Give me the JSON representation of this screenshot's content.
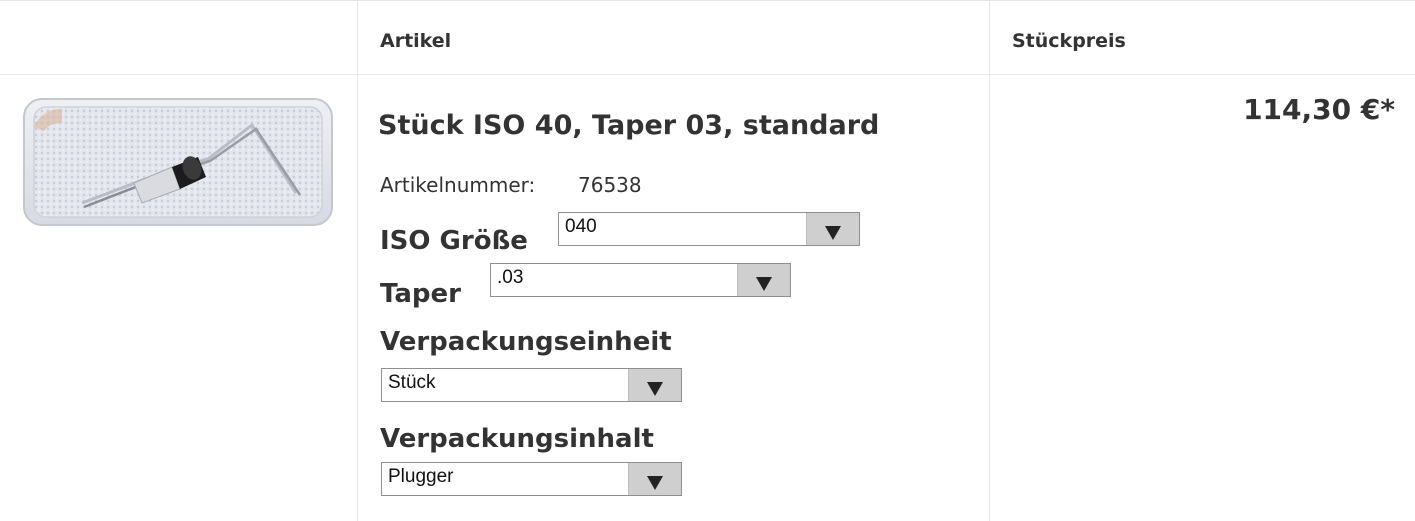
{
  "table": {
    "header": {
      "article": "Artikel",
      "unit_price": "Stückpreis"
    }
  },
  "product": {
    "image_alt": "Plugger",
    "title": "Stück ISO 40, Taper 03, standard",
    "sku_label": "Artikelnummer:",
    "sku_value": "76538",
    "price": "114,30 €*",
    "options": {
      "iso_size": {
        "label": "ISO Größe",
        "value": "040"
      },
      "taper": {
        "label": "Taper",
        "value": ".03"
      },
      "packaging_unit": {
        "label": "Verpackungseinheit",
        "value": "Stück"
      },
      "packaging_content": {
        "label": "Verpackungsinhalt",
        "value": "Plugger"
      }
    }
  },
  "colors": {
    "border": "#e6e6e6",
    "text": "#333333",
    "select_arrow_bg": "#cfcfcf"
  }
}
